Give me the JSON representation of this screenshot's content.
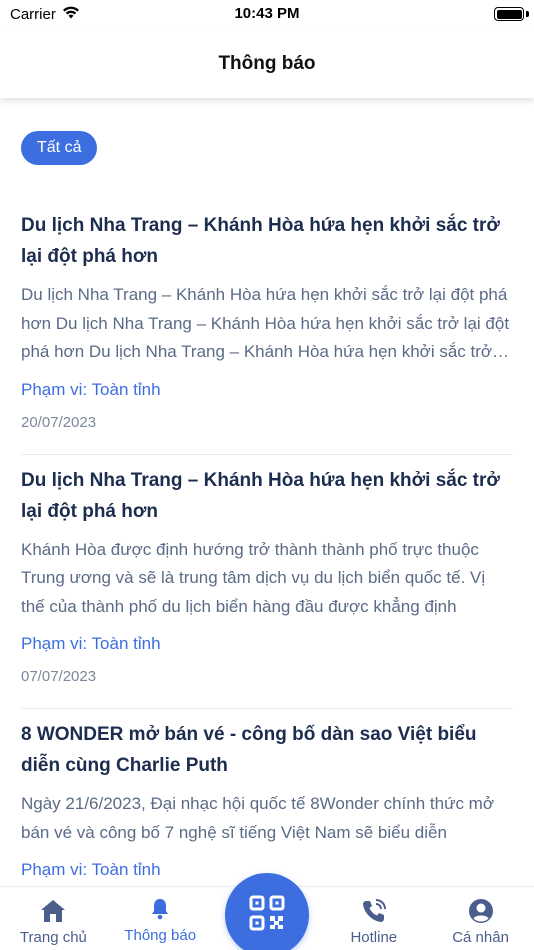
{
  "status_bar": {
    "carrier": "Carrier",
    "time": "10:43 PM"
  },
  "nav": {
    "title": "Thông báo"
  },
  "filter": {
    "label": "Tất cả"
  },
  "notifications": [
    {
      "title": "Du lịch Nha Trang – Khánh Hòa hứa hẹn khởi sắc trở lại đột phá hơn",
      "body": "Du lịch Nha Trang – Khánh Hòa hứa hẹn khởi sắc trở lại đột phá hơn Du lịch Nha Trang – Khánh Hòa hứa hẹn khởi sắc trở lại đột phá hơn Du lịch Nha Trang – Khánh Hòa hứa hẹn khởi sắc trở lại đột phá hơn",
      "scope": "Phạm vi: Toàn tỉnh",
      "date": "20/07/2023"
    },
    {
      "title": "Du lịch Nha Trang – Khánh Hòa hứa hẹn khởi sắc trở lại đột phá hơn",
      "body": "Khánh Hòa được định hướng trở thành thành phố trực thuộc Trung ương và sẽ là trung tâm dịch vụ du lịch biển quốc tế. Vị thế của thành phố du lịch biển hàng đầu được khẳng định",
      "scope": "Phạm vi: Toàn tỉnh",
      "date": "07/07/2023"
    },
    {
      "title": "8 WONDER mở bán vé - công bố dàn sao Việt biểu diễn cùng Charlie Puth",
      "body": "Ngày 21/6/2023, Đại nhạc hội quốc tế 8Wonder chính thức mở bán vé và công bố 7 nghệ sĩ tiếng Việt Nam sẽ biểu diễn",
      "scope": "Phạm vi: Toàn tỉnh",
      "date": ""
    }
  ],
  "tab_bar": {
    "home": "Trang chủ",
    "notifications": "Thông báo",
    "hotline": "Hotline",
    "profile": "Cá nhân"
  },
  "colors": {
    "accent": "#3c6ee0",
    "title": "#1c2d4f",
    "body": "#5b6b87",
    "tab_inactive": "#4b5d8a"
  },
  "icons": [
    "wifi-icon",
    "battery-icon",
    "home-icon",
    "bell-icon",
    "qr-code-icon",
    "phone-icon",
    "user-icon"
  ]
}
